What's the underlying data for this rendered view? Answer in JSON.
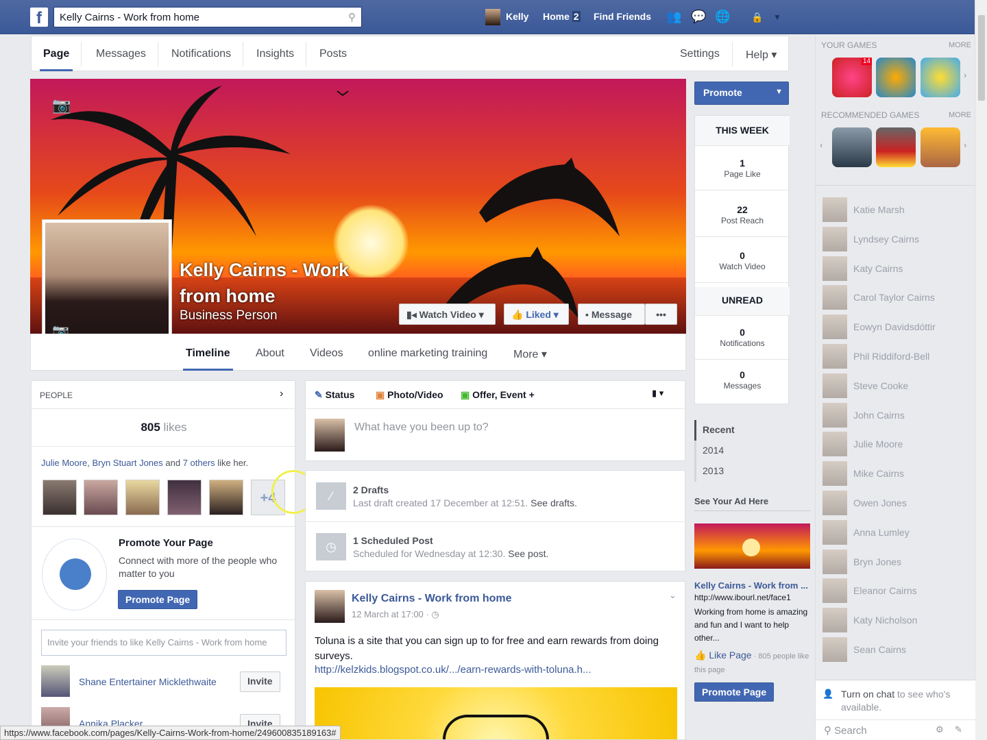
{
  "topbar": {
    "search_value": "Kelly Cairns - Work from home",
    "user": "Kelly",
    "home": "Home",
    "home_count": "2",
    "find_friends": "Find Friends"
  },
  "pagenav": {
    "items": [
      "Page",
      "Messages",
      "Notifications",
      "Insights",
      "Posts"
    ],
    "settings": "Settings",
    "help": "Help ▾"
  },
  "cover": {
    "name_line1": "Kelly Cairns - Work",
    "name_line2": "from home",
    "category": "Business Person",
    "watch_video": "Watch Video ▾",
    "liked": "Liked ▾",
    "message": "Message",
    "more": "•••"
  },
  "tabs": [
    "Timeline",
    "About",
    "Videos",
    "online marketing training",
    "More ▾"
  ],
  "people": {
    "header": "PEOPLE",
    "likes_count": "805",
    "likes_label": "likes",
    "friend1": "Julie Moore",
    "friend2": "Bryn Stuart Jones",
    "and": " and ",
    "others": "7 others",
    "like_her": " like her.",
    "more_count": "+4"
  },
  "promote": {
    "title": "Promote Your Page",
    "text": "Connect with more of the people who matter to you",
    "button": "Promote Page"
  },
  "invite": {
    "placeholder": "Invite your friends to like Kelly Cairns - Work from home",
    "button": "Invite",
    "people": [
      "Shane Entertainer Micklethwaite",
      "Annika Placker"
    ]
  },
  "composer": {
    "status": "Status",
    "photo": "Photo/Video",
    "offer": "Offer, Event +",
    "placeholder": "What have you been up to?"
  },
  "drafts": {
    "title": "2 Drafts",
    "text": "Last draft created 17 December at 12:51.",
    "link": "See drafts."
  },
  "scheduled": {
    "title": "1 Scheduled Post",
    "text": "Scheduled for Wednesday at 12:30.",
    "link": "See post."
  },
  "post": {
    "author": "Kelly Cairns - Work from home",
    "time": "12 March at 17:00 · ◷",
    "text": "Toluna is a site that you can sign up to for free and earn rewards from doing surveys.",
    "link": "http://kelzkids.blogspot.co.uk/.../earn-rewards-with-toluna.h..."
  },
  "promote_btn": "Promote",
  "this_week": {
    "header": "THIS WEEK",
    "stats": [
      {
        "value": "1",
        "label": "Page Like"
      },
      {
        "value": "22",
        "label": "Post Reach"
      },
      {
        "value": "0",
        "label": "Watch Video"
      }
    ]
  },
  "unread": {
    "header": "UNREAD",
    "stats": [
      {
        "value": "0",
        "label": "Notifications"
      },
      {
        "value": "0",
        "label": "Messages"
      }
    ]
  },
  "timeline_nav": [
    "Recent",
    "2014",
    "2013"
  ],
  "ad": {
    "header": "See Your Ad Here",
    "title": "Kelly Cairns - Work from ...",
    "url": "http://www.ibourl.net/face1",
    "text": "Working from home is amazing and fun and I want to help other...",
    "like_page": "Like Page",
    "like_count": "· 805 people like this page",
    "button": "Promote Page"
  },
  "games": {
    "your_games": "YOUR GAMES",
    "recommended": "RECOMMENDED GAMES",
    "more": "MORE",
    "badge": "14"
  },
  "chat": {
    "friends": [
      "Katie Marsh",
      "Lyndsey Cairns",
      "Katy Cairns",
      "Carol Taylor Cairns",
      "Eowyn Davidsdóttir",
      "Phil Riddiford-Bell",
      "Steve Cooke",
      "John Cairns",
      "Julie Moore",
      "Mike Cairns",
      "Owen Jones",
      "Anna Lumley",
      "Bryn Jones",
      "Eleanor Cairns",
      "Katy Nicholson",
      "Sean Cairns"
    ],
    "turn_on": "Turn on chat",
    "turn_on_rest": " to see who's available.",
    "search": "Search"
  },
  "status_url": "https://www.facebook.com/pages/Kelly-Cairns-Work-from-home/249600835189163#"
}
